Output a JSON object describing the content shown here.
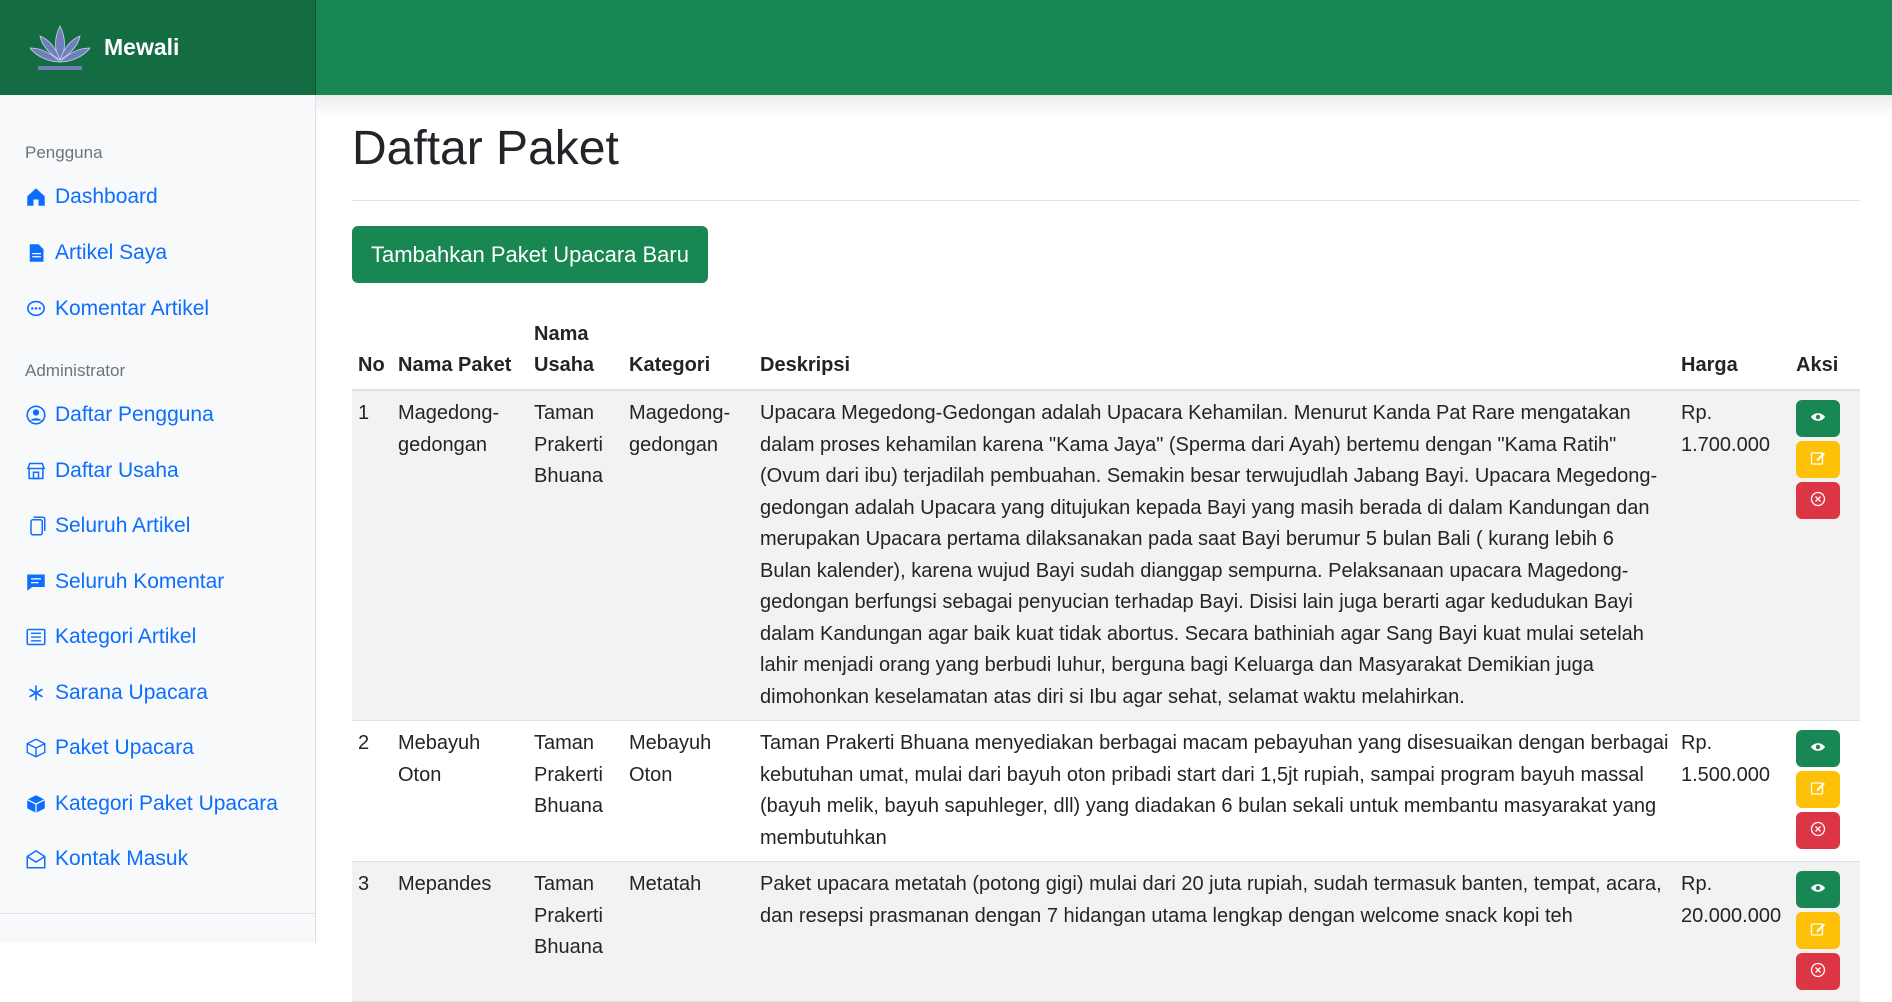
{
  "brand": {
    "name": "Mewali",
    "logo": "lotus-logo"
  },
  "sidebar": {
    "section_user": "Pengguna",
    "user_items": [
      {
        "label": "Dashboard",
        "icon": "house-icon"
      },
      {
        "label": "Artikel Saya",
        "icon": "document-icon"
      },
      {
        "label": "Komentar Artikel",
        "icon": "chat-dots-icon"
      }
    ],
    "section_admin": "Administrator",
    "admin_items": [
      {
        "label": "Daftar Pengguna",
        "icon": "person-circle-icon"
      },
      {
        "label": "Daftar Usaha",
        "icon": "shop-icon"
      },
      {
        "label": "Seluruh Artikel",
        "icon": "files-icon"
      },
      {
        "label": "Seluruh Komentar",
        "icon": "chat-left-text-icon"
      },
      {
        "label": "Kategori Artikel",
        "icon": "list-icon"
      },
      {
        "label": "Sarana Upacara",
        "icon": "snowflake-icon"
      },
      {
        "label": "Paket Upacara",
        "icon": "box-icon"
      },
      {
        "label": "Kategori Paket Upacara",
        "icon": "box-fill-icon"
      },
      {
        "label": "Kontak Masuk",
        "icon": "envelope-open-icon"
      }
    ]
  },
  "main": {
    "title": "Daftar Paket",
    "add_button": "Tambahkan Paket Upacara Baru",
    "table": {
      "headers": [
        "No",
        "Nama Paket",
        "Nama Usaha",
        "Kategori",
        "Deskripsi",
        "Harga",
        "Aksi"
      ],
      "rows": [
        {
          "no": "1",
          "nama_paket": "Magedong-gedongan",
          "nama_usaha": "Taman Prakerti Bhuana",
          "kategori": "Magedong-gedongan",
          "deskripsi": "Upacara Megedong-Gedongan adalah Upacara Kehamilan. Menurut Kanda Pat Rare mengatakan dalam proses kehamilan karena \"Kama Jaya\" (Sperma dari Ayah) bertemu dengan \"Kama Ratih\" (Ovum dari ibu) terjadilah pembuahan. Semakin besar terwujudlah Jabang Bayi. Upacara Megedong-gedongan adalah Upacara yang ditujukan kepada Bayi yang masih berada di dalam Kandungan dan merupakan Upacara pertama dilaksanakan pada saat Bayi berumur 5 bulan Bali ( kurang lebih 6 Bulan kalender), karena wujud Bayi sudah dianggap sempurna. Pelaksanaan upacara Magedong-gedongan berfungsi sebagai penyucian terhadap Bayi. Disisi lain juga berarti agar kedudukan Bayi dalam Kandungan agar baik kuat tidak abortus. Secara bathiniah agar Sang Bayi kuat mulai setelah lahir menjadi orang yang berbudi luhur, berguna bagi Keluarga dan Masyarakat Demikian juga dimohonkan keselamatan atas diri si Ibu agar sehat, selamat waktu melahirkan.",
          "harga": "Rp. 1.700.000"
        },
        {
          "no": "2",
          "nama_paket": "Mebayuh Oton",
          "nama_usaha": "Taman Prakerti Bhuana",
          "kategori": "Mebayuh Oton",
          "deskripsi": "Taman Prakerti Bhuana menyediakan berbagai macam pebayuhan yang disesuaikan dengan berbagai kebutuhan umat, mulai dari bayuh oton pribadi start dari 1,5jt rupiah, sampai program bayuh massal (bayuh melik, bayuh sapuhleger, dll) yang diadakan 6 bulan sekali untuk membantu masyarakat yang membutuhkan",
          "harga": "Rp. 1.500.000"
        },
        {
          "no": "3",
          "nama_paket": "Mepandes",
          "nama_usaha": "Taman Prakerti Bhuana",
          "kategori": "Metatah",
          "deskripsi": "Paket upacara metatah (potong gigi) mulai dari 20 juta rupiah, sudah termasuk banten, tempat, acara, dan resepsi prasmanan dengan 7 hidangan utama lengkap dengan welcome snack kopi teh",
          "harga": "Rp. 20.000.000"
        }
      ]
    },
    "actions": {
      "view": "eye-icon",
      "edit": "pencil-square-icon",
      "delete": "x-circle-icon"
    }
  },
  "colors": {
    "primary_green": "#198754",
    "brand_dark_green": "#146c43",
    "link_blue": "#0d6efd",
    "warning": "#ffc107",
    "danger": "#dc3545"
  }
}
